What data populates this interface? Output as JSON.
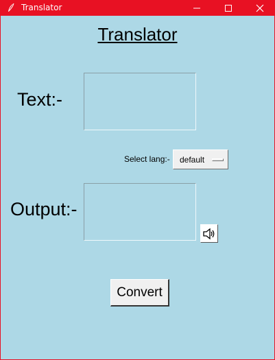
{
  "window": {
    "title": "Translator",
    "titlebar_color": "#e81123",
    "background_color": "#add8e6"
  },
  "heading": "Translator",
  "input": {
    "label": "Text:-",
    "value": ""
  },
  "language": {
    "label": "Select lang:-",
    "selected": "default"
  },
  "output": {
    "label": "Output:-",
    "value": ""
  },
  "buttons": {
    "convert_label": "Convert",
    "speaker_icon": "speaker-icon"
  }
}
